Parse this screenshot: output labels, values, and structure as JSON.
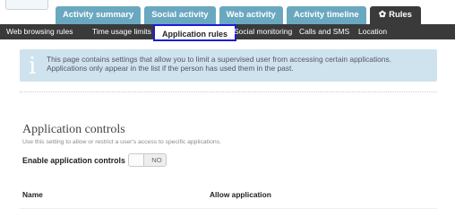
{
  "main_tabs": [
    {
      "label": "Activity summary"
    },
    {
      "label": "Social activity"
    },
    {
      "label": "Web activity"
    },
    {
      "label": "Activity timeline"
    },
    {
      "label": "Rules",
      "icon": "gear-icon",
      "active": true
    }
  ],
  "sub_nav": [
    {
      "label": "Web browsing rules"
    },
    {
      "label": "Time usage limits"
    },
    {
      "label": "Application rules",
      "active": true
    },
    {
      "label": "Social monitoring"
    },
    {
      "label": "Calls and SMS"
    },
    {
      "label": "Location"
    }
  ],
  "info": {
    "icon": "info-icon",
    "text": "This page contains settings that allow you to limit a supervised user from accessing certain applications. Applications only appear in the list if the person has used them in the past."
  },
  "section": {
    "title": "Application controls",
    "description": "Use this setting to allow or restrict a user's access to specific applications.",
    "enable_label": "Enable application controls",
    "toggle_value": "NO"
  },
  "table": {
    "columns": [
      "Name",
      "Allow application"
    ]
  },
  "colors": {
    "tab_blue": "#6aa8c0",
    "nav_dark": "#3a3a3a",
    "info_bg": "#cfe3ee",
    "highlight": "#1b1bd6"
  }
}
